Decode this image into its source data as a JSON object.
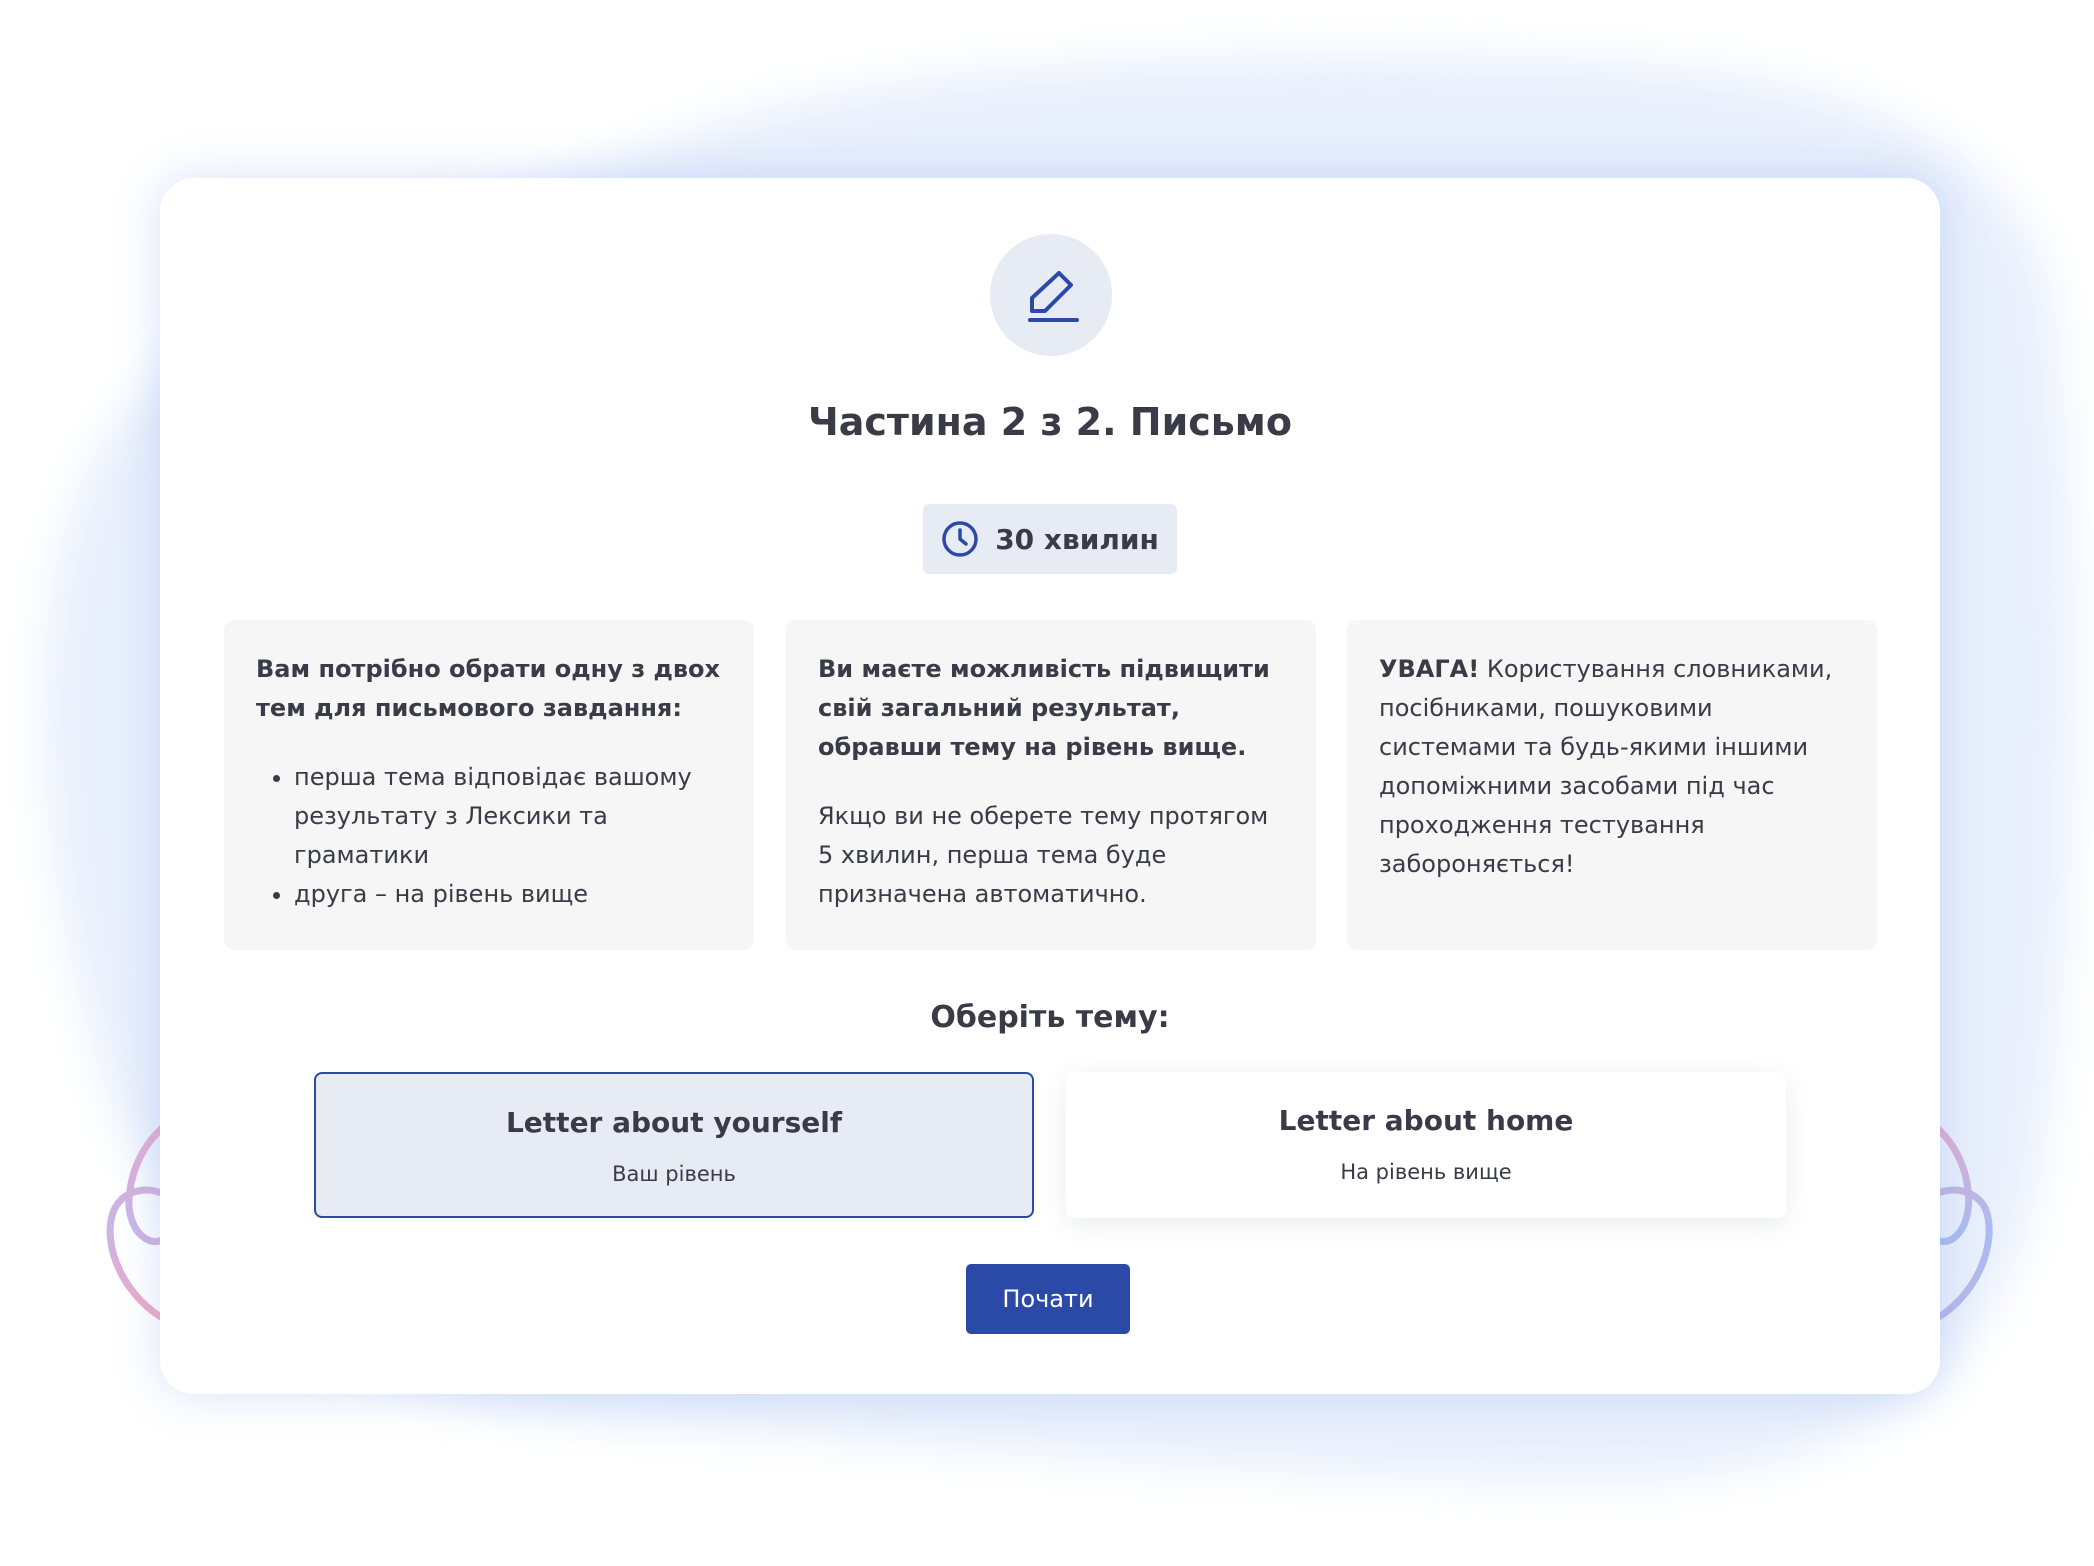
{
  "colors": {
    "accent": "#2b4aa8",
    "text": "#3a3b47",
    "icon_bg": "#e6ebf4",
    "box_bg": "#f6f6f7",
    "blob": "#e8effc",
    "arrow_pink": "#f2a9c4",
    "arrow_purple": "#b9b7ea"
  },
  "header": {
    "icon": "pencil-edit-icon",
    "title": "Частина 2 з 2. Письмо"
  },
  "timer": {
    "icon": "clock-icon",
    "label": "30 хвилин"
  },
  "info": [
    {
      "heading": "Вам потрібно обрати одну з двох тем для письмового завдання:",
      "items": [
        "перша тема відповідає вашому результату з Лексики та граматики",
        "друга – на рівень вище"
      ]
    },
    {
      "heading": "Ви маєте можливість підвищити свій загальний результат, обравши тему на рівень вище.",
      "text": "Якщо ви не оберете тему протягом 5 хвилин, перша тема буде призначена автоматично."
    },
    {
      "warning_label": "УВАГА!",
      "text": "Користування словниками, посібниками, пошуковими системами та будь-якими іншими допоміжними засобами під час проходження тестування забороняється!"
    }
  ],
  "topic_selection": {
    "title": "Оберіть тему:",
    "options": [
      {
        "title": "Letter about yourself",
        "subtitle": "Ваш рівень",
        "selected": true
      },
      {
        "title": "Letter about home",
        "subtitle": "На рівень вище",
        "selected": false
      }
    ]
  },
  "start_button": {
    "label": "Почати"
  }
}
